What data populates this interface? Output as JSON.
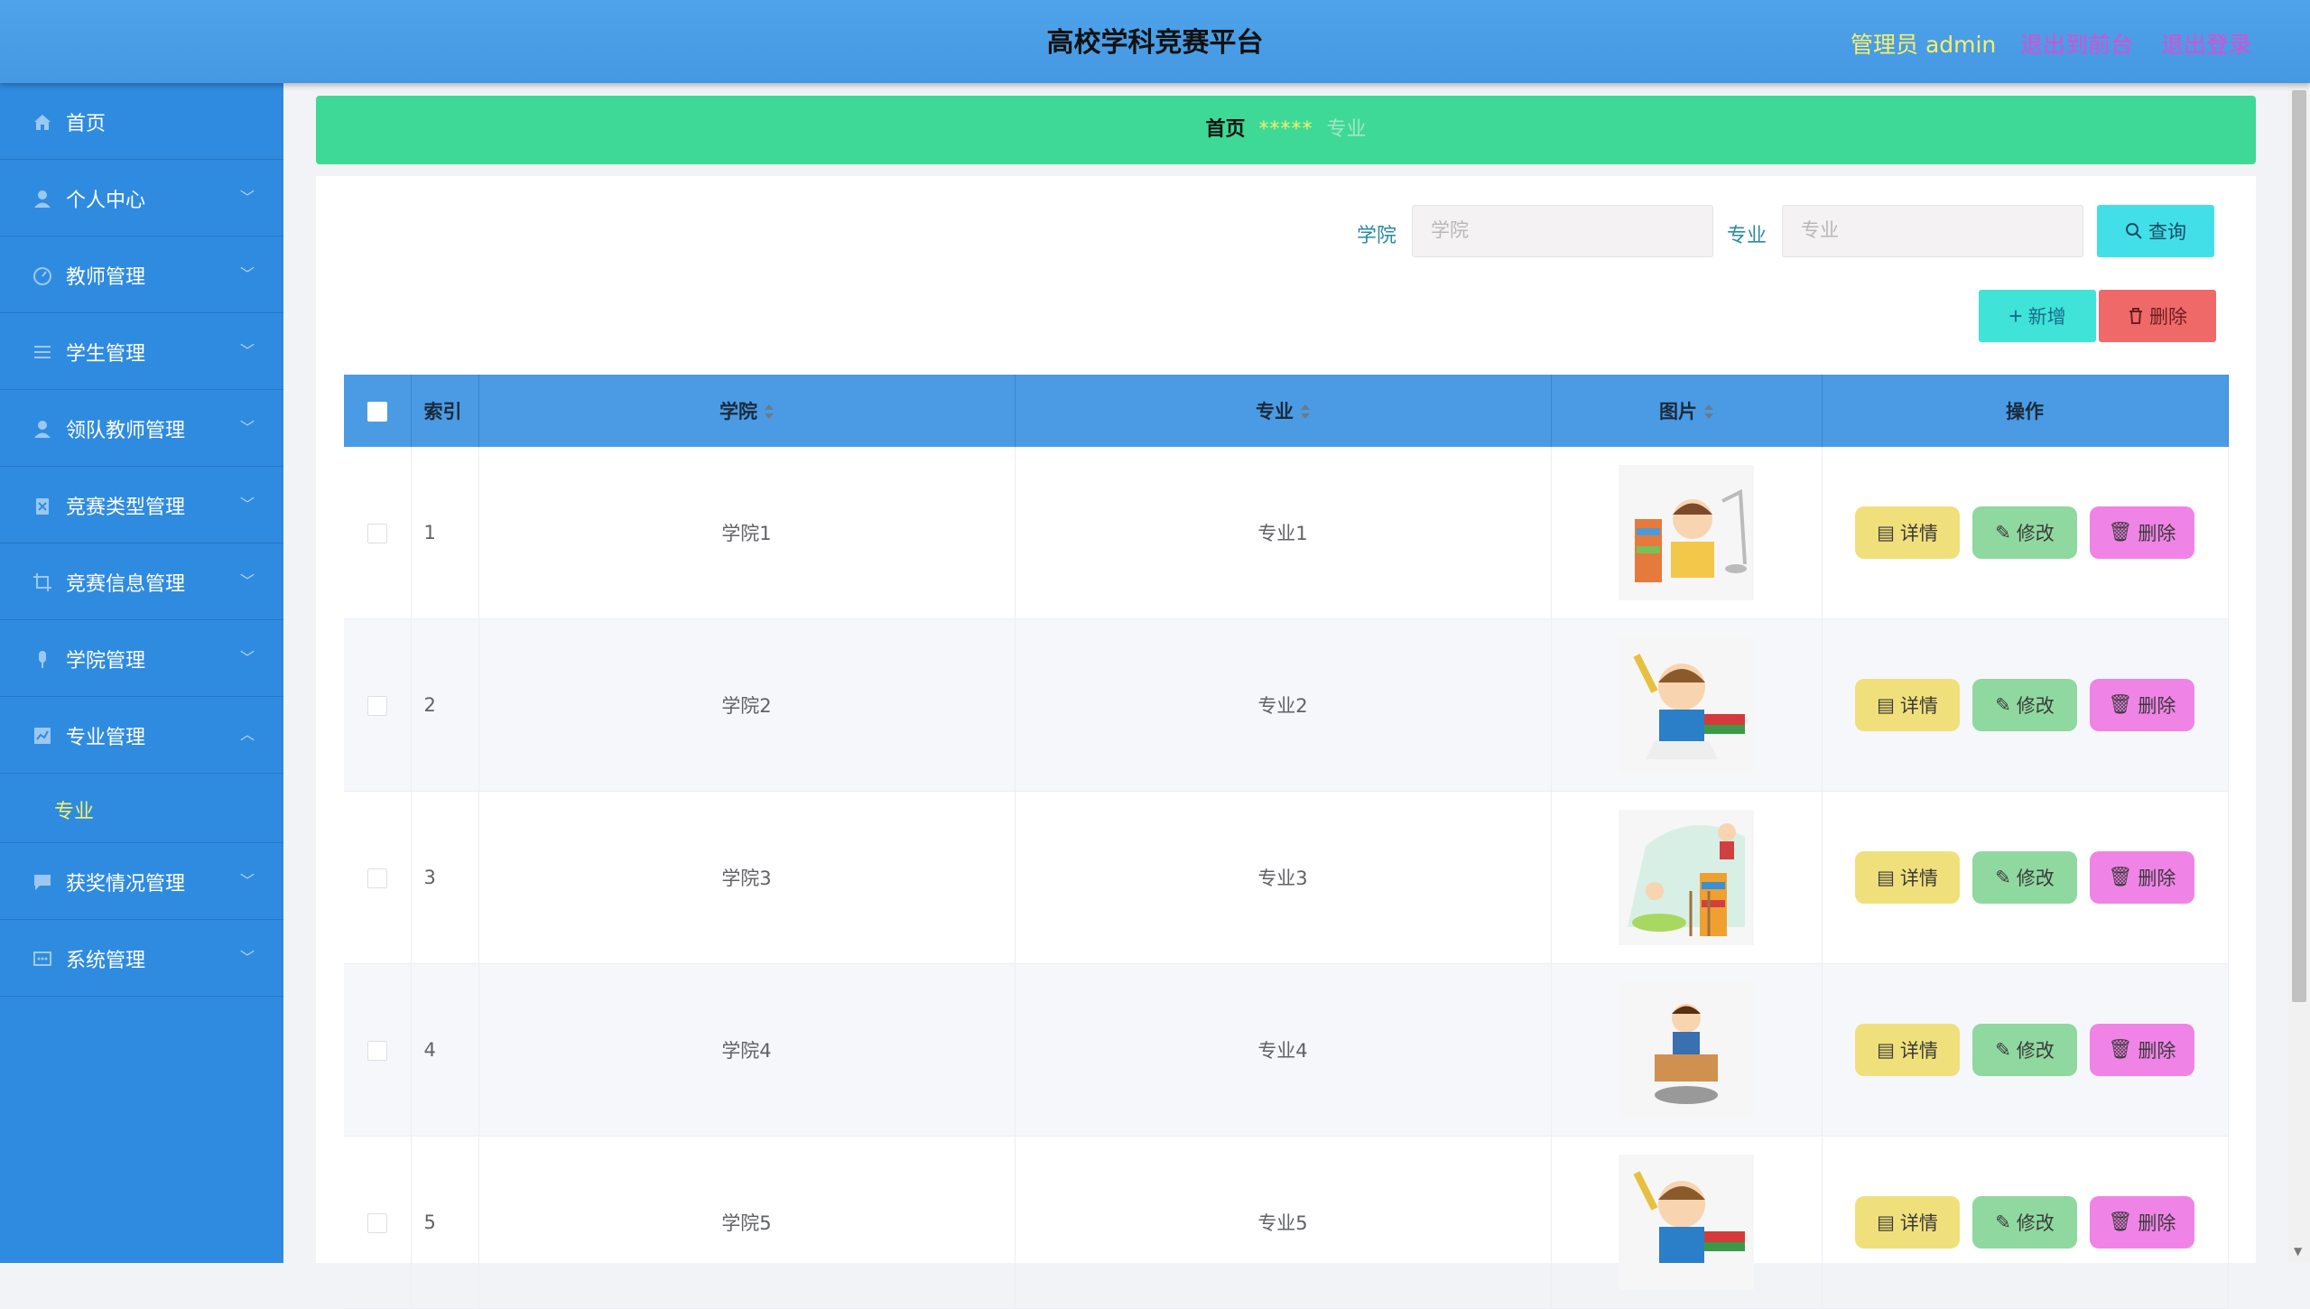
{
  "header": {
    "title": "高校学科竞赛平台",
    "admin": "管理员 admin",
    "to_front": "退出到前台",
    "logout": "退出登录"
  },
  "sidebar": {
    "items": [
      {
        "label": "首页",
        "icon": "home-icon"
      },
      {
        "label": "个人中心",
        "icon": "user-icon"
      },
      {
        "label": "教师管理",
        "icon": "gauge-icon"
      },
      {
        "label": "学生管理",
        "icon": "list-icon"
      },
      {
        "label": "领队教师管理",
        "icon": "user-icon"
      },
      {
        "label": "竞赛类型管理",
        "icon": "clipboard-icon"
      },
      {
        "label": "竞赛信息管理",
        "icon": "crop-icon"
      },
      {
        "label": "学院管理",
        "icon": "microphone-icon"
      },
      {
        "label": "专业管理",
        "icon": "chart-icon"
      },
      {
        "label": "获奖情况管理",
        "icon": "chat-icon"
      },
      {
        "label": "系统管理",
        "icon": "message-icon"
      }
    ],
    "sub_item": "专业"
  },
  "breadcrumb": {
    "home": "首页",
    "separator": "*****",
    "current": "专业"
  },
  "search": {
    "college_label": "学院",
    "college_placeholder": "学院",
    "major_label": "专业",
    "major_placeholder": "专业",
    "query_button": "查询"
  },
  "actions": {
    "add_button": "新增",
    "delete_button": "删除"
  },
  "table": {
    "columns": [
      "索引",
      "学院",
      "专业",
      "图片",
      "操作"
    ],
    "rows": [
      {
        "index": "1",
        "college": "学院1",
        "major": "专业1"
      },
      {
        "index": "2",
        "college": "学院2",
        "major": "专业2"
      },
      {
        "index": "3",
        "college": "学院3",
        "major": "专业3"
      },
      {
        "index": "4",
        "college": "学院4",
        "major": "专业4"
      },
      {
        "index": "5",
        "college": "学院5",
        "major": "专业5"
      }
    ],
    "row_actions": {
      "detail": "详情",
      "edit": "修改",
      "delete": "删除"
    }
  },
  "colors": {
    "header_bg": "#4ea3ea",
    "sidebar_bg": "#2f8be0",
    "breadcrumb_bg": "#3ed996",
    "accent_yellow": "#f7f06a",
    "accent_pink": "#e04bd6"
  }
}
